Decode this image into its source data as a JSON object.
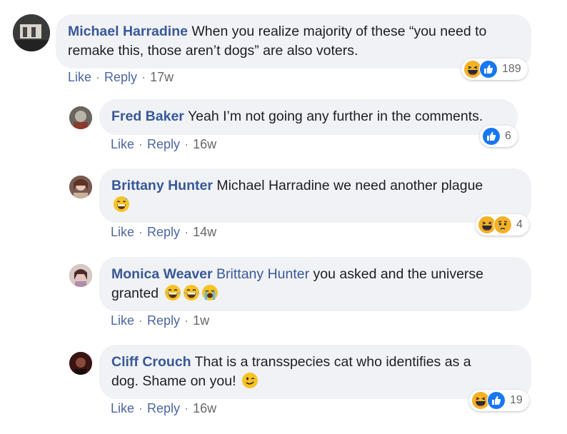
{
  "actions": {
    "like": "Like",
    "reply": "Reply",
    "sep": "·"
  },
  "colors": {
    "link": "#385898",
    "bubble": "#f0f2f5",
    "like_blue": "#1877f2",
    "haha_yellow": "#f7b125"
  },
  "comments": [
    {
      "author": "Michael Harradine",
      "text_line1": " When you realize majority of these “you need to",
      "text_line2": "remake this, those aren’t dogs” are also voters.",
      "time": "17w",
      "reaction_count": "189",
      "reaction_icons": [
        "haha-icon",
        "like-icon"
      ]
    },
    {
      "author": "Fred Baker",
      "text": " Yeah I’m not going any further in the comments.",
      "time": "16w",
      "reaction_count": "6",
      "reaction_icons": [
        "like-icon"
      ]
    },
    {
      "author": "Brittany Hunter",
      "text": " Michael Harradine we need another plague",
      "emoji": "grinning-sweat-emoji",
      "time": "14w",
      "reaction_count": "4",
      "reaction_icons": [
        "haha-icon",
        "sad-icon"
      ]
    },
    {
      "author": "Monica Weaver",
      "mention": " Brittany Hunter",
      "text": " you asked and the universe",
      "text_line2": "granted ",
      "emojis": [
        "laughing-emoji",
        "laughing-emoji",
        "crying-emoji"
      ],
      "time": "1w"
    },
    {
      "author": "Cliff Crouch",
      "text_line1": " That is a transspecies cat who identifies as a",
      "text_line2": "dog. Shame on you! ",
      "emoji": "winking-emoji",
      "time": "16w",
      "reaction_count": "19",
      "reaction_icons": [
        "haha-icon",
        "like-icon"
      ]
    }
  ]
}
